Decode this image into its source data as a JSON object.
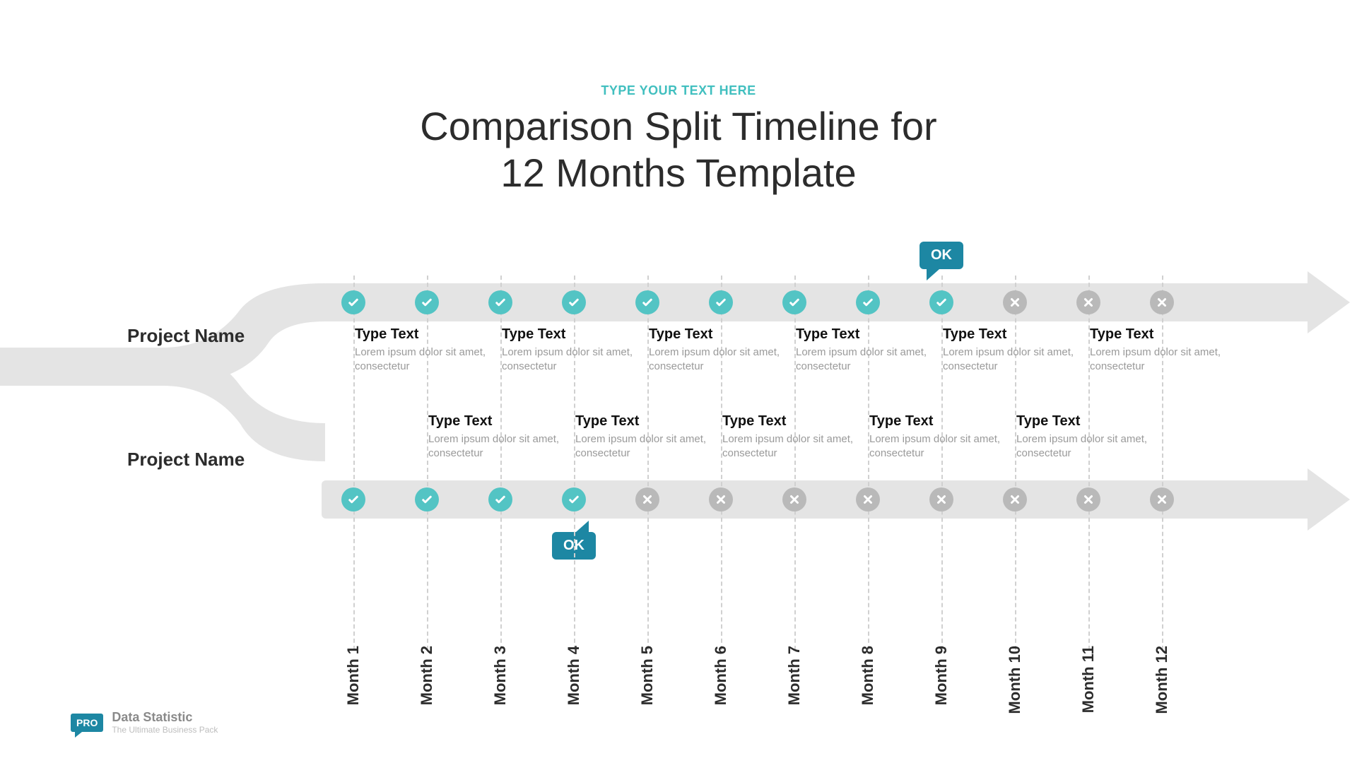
{
  "eyebrow": "TYPE YOUR TEXT HERE",
  "title_line1": "Comparison Split Timeline for",
  "title_line2": "12 Months Template",
  "months": [
    "Month 1",
    "Month 2",
    "Month 3",
    "Month 4",
    "Month 5",
    "Month 6",
    "Month 7",
    "Month 8",
    "Month 9",
    "Month 10",
    "Month 11",
    "Month 12"
  ],
  "project_top": {
    "label": "Project Name",
    "status": [
      "ok",
      "ok",
      "ok",
      "ok",
      "ok",
      "ok",
      "ok",
      "ok",
      "ok",
      "no",
      "no",
      "no"
    ],
    "callout": {
      "month_index": 8,
      "text": "OK"
    },
    "blocks": [
      {
        "month_index": 0,
        "heading": "Type Text",
        "body": "Lorem ipsum dolor sit amet, consectetur"
      },
      {
        "month_index": 2,
        "heading": "Type Text",
        "body": "Lorem ipsum dolor sit amet, consectetur"
      },
      {
        "month_index": 4,
        "heading": "Type Text",
        "body": "Lorem ipsum dolor sit amet, consectetur"
      },
      {
        "month_index": 6,
        "heading": "Type Text",
        "body": "Lorem ipsum dolor sit amet, consectetur"
      },
      {
        "month_index": 8,
        "heading": "Type Text",
        "body": "Lorem ipsum dolor sit amet, consectetur"
      },
      {
        "month_index": 10,
        "heading": "Type Text",
        "body": "Lorem ipsum dolor sit amet, consectetur"
      }
    ]
  },
  "project_bottom": {
    "label": "Project Name",
    "status": [
      "ok",
      "ok",
      "ok",
      "ok",
      "no",
      "no",
      "no",
      "no",
      "no",
      "no",
      "no",
      "no"
    ],
    "callout": {
      "month_index": 3,
      "text": "OK"
    },
    "blocks": [
      {
        "month_index": 1,
        "heading": "Type Text",
        "body": "Lorem ipsum dolor sit amet, consectetur"
      },
      {
        "month_index": 3,
        "heading": "Type Text",
        "body": "Lorem ipsum dolor sit amet, consectetur"
      },
      {
        "month_index": 5,
        "heading": "Type Text",
        "body": "Lorem ipsum dolor sit amet, consectetur"
      },
      {
        "month_index": 7,
        "heading": "Type Text",
        "body": "Lorem ipsum dolor sit amet, consectetur"
      },
      {
        "month_index": 9,
        "heading": "Type Text",
        "body": "Lorem ipsum dolor sit amet, consectetur"
      }
    ]
  },
  "colors": {
    "ok": "#53c4c4",
    "no": "#b9b9b9",
    "accent": "#1d87a3",
    "bar": "#e4e4e4"
  },
  "footer": {
    "badge": "PRO",
    "title": "Data Statistic",
    "subtitle": "The Ultimate Business Pack"
  },
  "chart_data": {
    "type": "table",
    "title": "Comparison Split Timeline for 12 Months Template",
    "categories": [
      "Month 1",
      "Month 2",
      "Month 3",
      "Month 4",
      "Month 5",
      "Month 6",
      "Month 7",
      "Month 8",
      "Month 9",
      "Month 10",
      "Month 11",
      "Month 12"
    ],
    "series": [
      {
        "name": "Project Name (top)",
        "values": [
          1,
          1,
          1,
          1,
          1,
          1,
          1,
          1,
          1,
          0,
          0,
          0
        ]
      },
      {
        "name": "Project Name (bottom)",
        "values": [
          1,
          1,
          1,
          1,
          0,
          0,
          0,
          0,
          0,
          0,
          0,
          0
        ]
      }
    ],
    "legend": {
      "1": "check / done",
      "0": "cross / not done"
    },
    "annotations": [
      {
        "series": 0,
        "category_index": 8,
        "text": "OK"
      },
      {
        "series": 1,
        "category_index": 3,
        "text": "OK"
      }
    ]
  }
}
